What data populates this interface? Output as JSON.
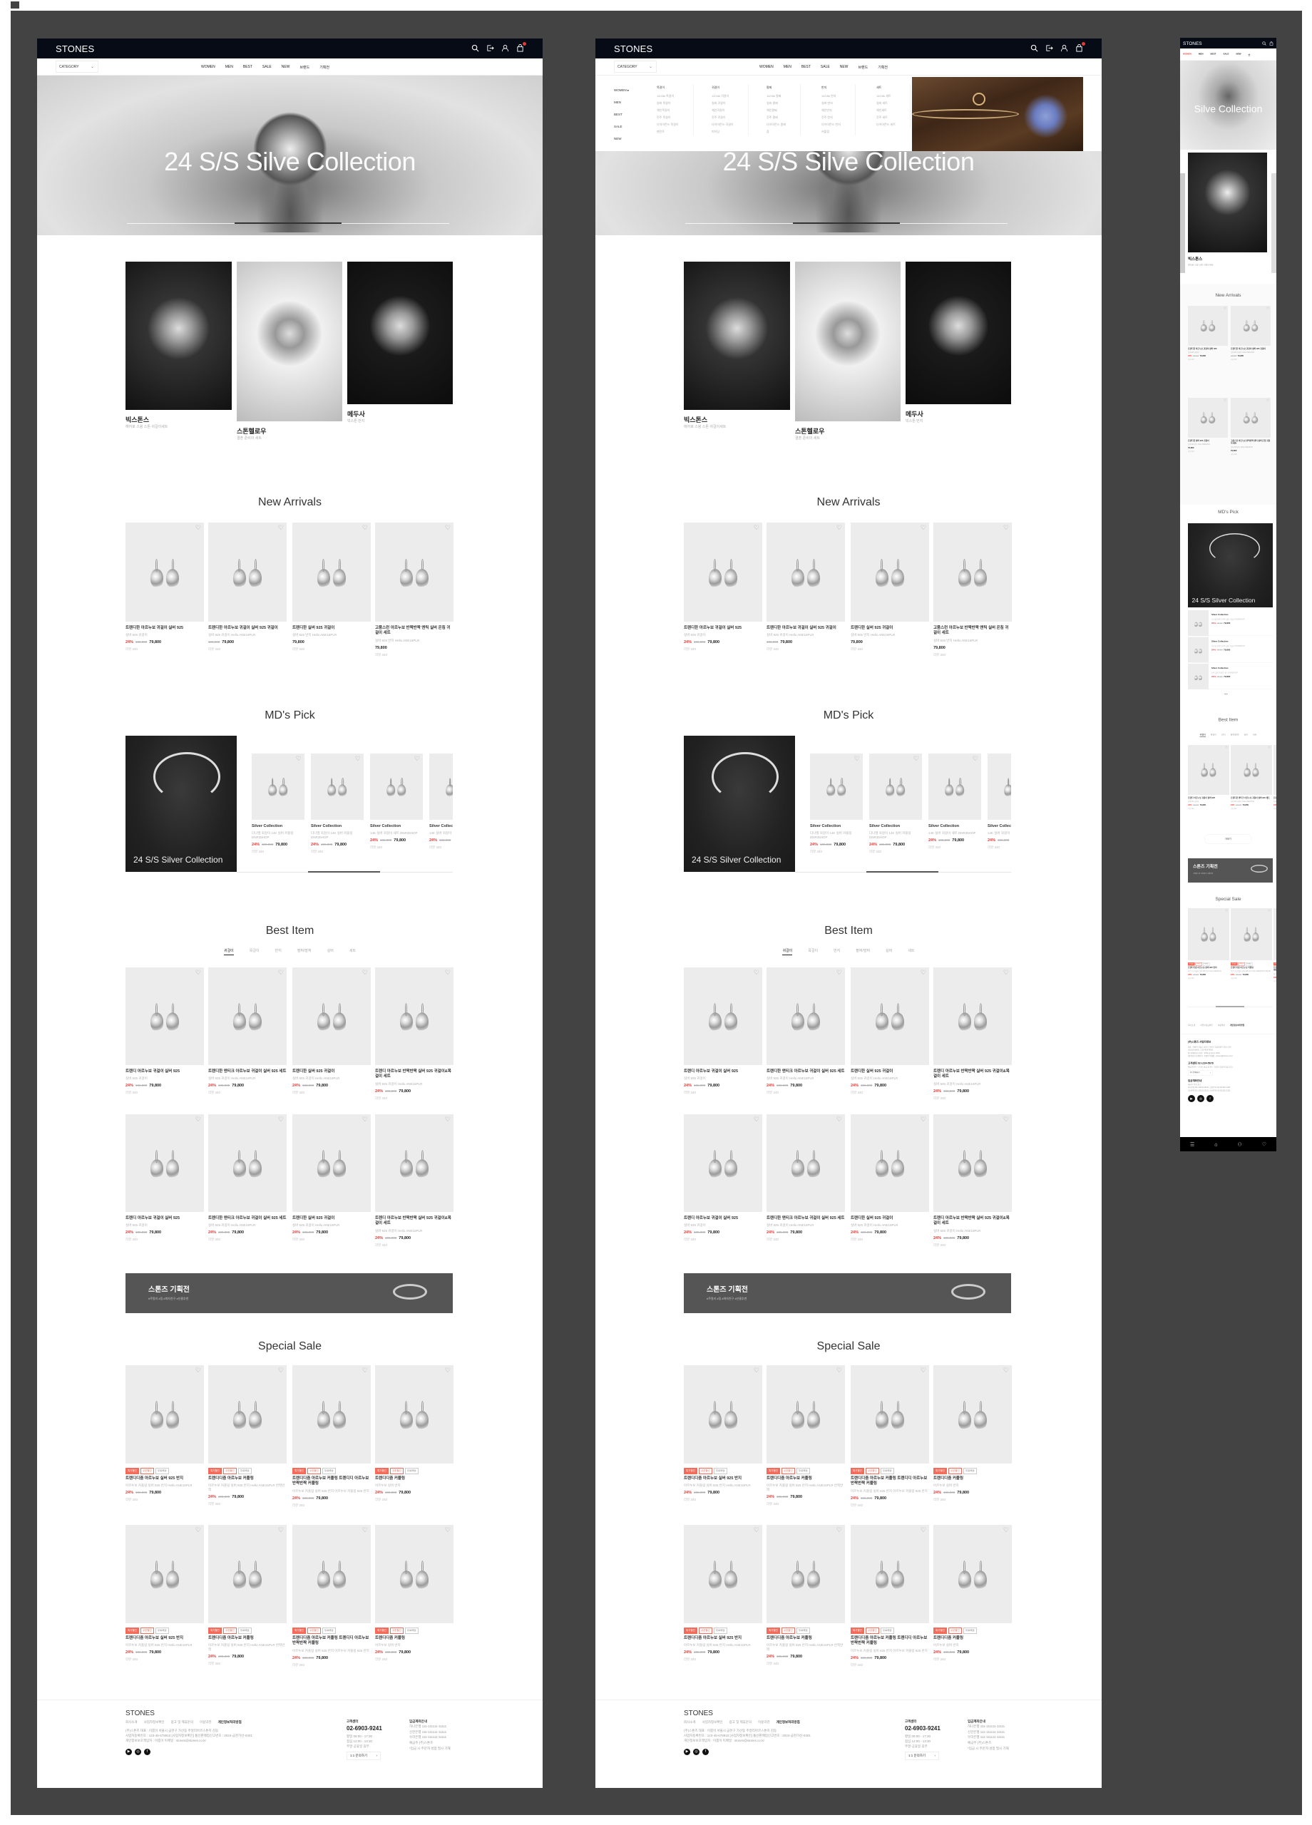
{
  "colors": {
    "canvas": "#434343",
    "header": "#060b16",
    "accent": "#e53935",
    "promo": "#555555",
    "badge": "#f26b5b"
  },
  "brand": "STONES",
  "header": {
    "icons": [
      "search-icon",
      "logout-icon",
      "user-icon",
      "cart-icon"
    ]
  },
  "nav": {
    "category_label": "CATEGORY",
    "items": [
      "WOMEN",
      "MEN",
      "BEST",
      "SALE",
      "NEW",
      "브랜드",
      "기획전"
    ]
  },
  "hero": {
    "title": "24 S/S Silve Collection",
    "active_slide": 2,
    "slide_count": 3
  },
  "featured": [
    {
      "title": "빅스톤스",
      "sub": "에어로 스윙 스톤 귀걸이세트"
    },
    {
      "title": "스톤헬로우",
      "sub": "결혼 준비의 세트"
    },
    {
      "title": "메두사",
      "sub": "빅스톤 반지"
    }
  ],
  "new_arrivals": {
    "title": "New Arrivals",
    "products": [
      {
        "name": "트렌디한 아르누보 귀걸이 실버 925",
        "desc": "실버 925 귀걸이",
        "discount": "24%",
        "original": "106,000",
        "price": "79,800",
        "reviews": "리뷰 340"
      },
      {
        "name": "트렌디한 아르누보 귀걸이 실버 925 귀걸이",
        "desc": "실버 925 귀걸이 Hello ANE16PLR",
        "original": "106,000",
        "price": "79,800",
        "reviews": "리뷰 340"
      },
      {
        "name": "트렌디한 실버 925 귀걸이",
        "desc": "실버 925 반지 Hello ANE16PLR",
        "price": "79,800",
        "reviews": "리뷰 340"
      },
      {
        "name": "고품스런 아르누보 반짝반짝 앤틱 실버 은침 귀걸이 세트",
        "desc": "실버 925 반지 Hello ANE16PLR",
        "price": "79,800",
        "reviews": "리뷰 340"
      }
    ]
  },
  "md_pick": {
    "title": "MD's Pick",
    "banner_text": "24 S/S Silver Collection",
    "scroll_progress": 0.33,
    "products": [
      {
        "name": "Silver Collection",
        "desc": "다나엘 귀걸이 14K 실버 커플링 DNR35HOP",
        "discount": "24%",
        "original": "106,000",
        "price": "79,800",
        "reviews": "리뷰 340"
      },
      {
        "name": "Silver Collection",
        "desc": "다나엘 귀걸이 14K 실버 커플링 DNR35HOP",
        "discount": "24%",
        "original": "106,000",
        "price": "79,800",
        "reviews": "리뷰 340"
      },
      {
        "name": "Silver Collection",
        "desc": "14K 실버 귀걸이 세트 DNR35HOP",
        "discount": "24%",
        "original": "106,000",
        "price": "79,800",
        "reviews": "리뷰 340"
      },
      {
        "name": "Silver Collection",
        "desc": "14K 실버 귀걸이",
        "discount": "24%",
        "original": "106,000",
        "price": "79,800",
        "reviews": "리뷰 340"
      }
    ]
  },
  "best": {
    "title": "Best Item",
    "tabs": [
      "귀걸이",
      "목걸이",
      "반지",
      "팔찌/발찌",
      "실버",
      "세트"
    ],
    "active_tab": 0,
    "more_label": "더보기",
    "products": [
      {
        "name": "트렌디 아르누보 귀걸이 실버 925",
        "desc": "실버 925 귀걸이",
        "discount": "24%",
        "original": "106,000",
        "price": "79,800",
        "reviews": "리뷰 340"
      },
      {
        "name": "트렌디한 앤티크 아르누보 귀걸이 실버 925 세트",
        "desc": "실버 925 귀걸이 Hello ANE16PLR",
        "discount": "24%",
        "original": "106,000",
        "price": "79,800",
        "reviews": "리뷰 340"
      },
      {
        "name": "트렌디한 실버 925 귀걸이",
        "desc": "실버 925 귀걸이 Hello ANE16PLR",
        "discount": "24%",
        "original": "106,000",
        "price": "79,800",
        "reviews": "리뷰 340"
      },
      {
        "name": "트렌디 아르누보 반짝반짝 실버 925 귀걸이&목걸이 세트",
        "desc": "실버 925 귀걸이 Hello ANE16PLR",
        "discount": "24%",
        "original": "106,000",
        "price": "79,800",
        "reviews": "리뷰 340"
      },
      {
        "name": "트렌디 아르누보 귀걸이 실버 925",
        "desc": "실버 925 귀걸이",
        "discount": "24%",
        "original": "106,000",
        "price": "79,800",
        "reviews": "리뷰 340"
      },
      {
        "name": "트렌디한 앤티크 아르누보 귀걸이 실버 925 세트",
        "desc": "실버 925 귀걸이 Hello ANE16PLR",
        "discount": "24%",
        "original": "106,000",
        "price": "79,800",
        "reviews": "리뷰 340"
      },
      {
        "name": "트렌디한 실버 925 귀걸이",
        "desc": "실버 925 귀걸이 Hello ANE16PLR",
        "discount": "24%",
        "original": "106,000",
        "price": "79,800",
        "reviews": "리뷰 340"
      },
      {
        "name": "트렌디 아르누보 반짝반짝 실버 925 귀걸이&목걸이 세트",
        "desc": "실버 925 귀걸이 Hello ANE16PLR",
        "discount": "24%",
        "original": "106,000",
        "price": "79,800",
        "reviews": "리뷰 340"
      }
    ]
  },
  "promo": {
    "title": "스톤즈 기획전",
    "tags": "#주얼리 #링 #여자친구 #선물추천"
  },
  "special": {
    "title": "Special Sale",
    "badges": [
      "특가할인",
      "쿠폰할인",
      "무료배송"
    ],
    "products": [
      {
        "name": "트렌디디즘 아르누보 실버 925 반지",
        "desc": "아르누보 커플링 실버 925 반지 Hello ANE16PLR",
        "discount": "24%",
        "original": "106,000",
        "price": "79,800",
        "reviews": "리뷰 340"
      },
      {
        "name": "트렌디디즘 아르누보 커플링",
        "desc": "아르누보 커플링 실버 925 반지 Hello ANE16PLR 반짝반짝",
        "discount": "24%",
        "original": "106,000",
        "price": "79,800",
        "reviews": "리뷰 340"
      },
      {
        "name": "트렌디디즘 아르누보 커플링 트렌디디 아르누보 반짝반짝 커플링",
        "desc": "아르누보 커플링 실버 925 반지 아르누보 커플링 925 반지",
        "discount": "24%",
        "original": "106,000",
        "price": "79,800",
        "reviews": "리뷰 340"
      },
      {
        "name": "트렌디디즘 커플링",
        "desc": "아르누보 실버 반지",
        "discount": "24%",
        "original": "106,000",
        "price": "79,800",
        "reviews": "리뷰 340"
      },
      {
        "name": "트렌디디즘 아르누보 실버 925 반지",
        "desc": "아르누보 커플링 실버 925 반지 Hello ANE16PLR",
        "discount": "24%",
        "original": "106,000",
        "price": "79,800",
        "reviews": "리뷰 340"
      },
      {
        "name": "트렌디디즘 아르누보 커플링",
        "desc": "아르누보 커플링 실버 925 반지 Hello ANE16PLR 반짝반짝",
        "discount": "24%",
        "original": "106,000",
        "price": "79,800",
        "reviews": "리뷰 340"
      },
      {
        "name": "트렌디디즘 아르누보 커플링 트렌디디 아르누보 반짝반짝 커플링",
        "desc": "아르누보 커플링 실버 925 반지 아르누보 커플링 925 반지",
        "discount": "24%",
        "original": "106,000",
        "price": "79,800",
        "reviews": "리뷰 340"
      },
      {
        "name": "트렌디디즘 커플링",
        "desc": "아르누보 실버 반지",
        "discount": "24%",
        "original": "106,000",
        "price": "79,800",
        "reviews": "리뷰 340"
      }
    ]
  },
  "footer": {
    "brand": "STONES",
    "links": [
      "회사소개",
      "사업자정보확인",
      "광고 및 제휴문의",
      "이용약관",
      "개인정보처리방침"
    ],
    "info": [
      "(주)스톤즈  대표 : 이룸이  서울시 금천구 가산동 주얼리아르스톤지 김동",
      "사업자등록번호 : 123-45-678910 [사업자정보확인]  통신판매업신고번호 : 2024-금천가산-0401",
      "개인정보보호책임자 : 이룸이  이메일 : stones@stones.co.kr"
    ],
    "cs_label": "고객센터",
    "phone": "02-6903-9241",
    "hours": [
      "평일 09:00 - 17:30",
      "점심 12:00 - 13:30",
      "주말·공휴일 휴무"
    ],
    "inquiry_label": "1:1 문의하기",
    "bank_label": "입금계좌안내",
    "bank_lines": [
      "하나은행 111-111111-11111",
      "신한은행 111-111111-11111",
      "우리은행 111-111111-11111",
      "예금주 (주)스톤즈",
      "*입금 시 주문자 성함 필시 기재"
    ],
    "social": [
      "youtube-icon",
      "instagram-icon",
      "facebook-icon"
    ]
  },
  "mega_menu": {
    "side": [
      "WOMEN",
      "MEN",
      "BEST",
      "SALE",
      "NEW"
    ],
    "active": "WOMEN",
    "columns": [
      {
        "title": "목걸이",
        "items": [
          "14/18k 목걸이",
          "실버 목걸이",
          "체인목걸이",
          "진주 목걸이",
          "다이아몬드 목걸이",
          "펜던트"
        ]
      },
      {
        "title": "귀걸이",
        "items": [
          "14/18k 귀걸이",
          "실버 귀걸이",
          "체인귀걸이",
          "진주 귀걸이",
          "다이아몬드 귀걸이",
          "피어싱"
        ]
      },
      {
        "title": "팔찌",
        "items": [
          "14/18k 팔찌",
          "실버 팔찌",
          "체인팔찌",
          "진주 팔찌",
          "다이아몬드 팔찌",
          "참"
        ]
      },
      {
        "title": "반지",
        "items": [
          "14/18k 반지",
          "실버 반지",
          "체인반지",
          "진주 반지",
          "다이아몬드 반지",
          "커플링"
        ]
      },
      {
        "title": "세트",
        "items": [
          "14/18k 세트",
          "실버 세트",
          "체인세트",
          "진주 세트",
          "다이아몬드 세트"
        ]
      }
    ]
  },
  "mobile": {
    "nav": [
      "WOMEN",
      "MEN",
      "BEST",
      "SALE",
      "NEW",
      "브"
    ],
    "hero_title": "Silve Collection",
    "footer_links": [
      "회사소개",
      "사업자정보확인",
      "이용약관",
      "개인정보처리방침"
    ],
    "company_title": "(주)스톤즈 사업자정보",
    "company_lines": [
      "대표 : 이룸이  서울시 금천구 가산동 주얼리아르스톤지 김동",
      "사업자등록번호 : 123-45-678910",
      "통신판매업신고번호 : 2024-금천가산-0401",
      "개인정보보호책임자 : 이룸이  이메일 : stones@stones.co.kr"
    ],
    "cs": "고객센터 02-1234-5678",
    "cs_hours": "평일 09:00 ~ 17:30, 점심 12:00 ~ 13:30 (주말/공휴일 휴무)",
    "bank_lines": [
      "예금주 (주)스톤즈",
      "하나은행 111-111111-11111, 신한은행 111-111111-11111",
      "기업은행 111-111111-11111, 우리은행 111-111111-11111"
    ],
    "tabbar": [
      "menu-icon",
      "home-icon",
      "user-icon",
      "heart-icon"
    ]
  }
}
